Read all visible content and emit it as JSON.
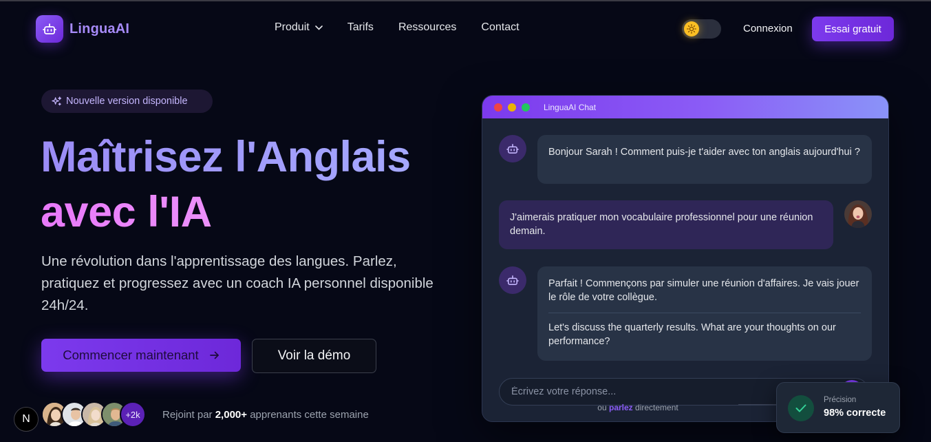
{
  "brand": {
    "name": "LinguaAI"
  },
  "nav": {
    "items": [
      {
        "label": "Produit",
        "has_dropdown": true
      },
      {
        "label": "Tarifs",
        "has_dropdown": false
      },
      {
        "label": "Ressources",
        "has_dropdown": false
      },
      {
        "label": "Contact",
        "has_dropdown": false
      }
    ],
    "theme_toggle": {
      "icon": "sun-icon",
      "state": "light"
    },
    "login_label": "Connexion",
    "trial_label": "Essai gratuit"
  },
  "hero": {
    "badge_label": "Nouvelle version disponible",
    "title_line1": "Maîtrisez l'Anglais",
    "title_line2": "avec l'IA",
    "subtitle": "Une révolution dans l'apprentissage des langues. Parlez, pratiquez et progressez avec un coach IA personnel disponible 24h/24.",
    "cta_primary": "Commencer maintenant",
    "cta_secondary": "Voir la démo",
    "social_proof": {
      "more_count": "+2k",
      "text_prefix": "Rejoint par",
      "count": "2,000+",
      "text_suffix": "apprenants cette semaine"
    }
  },
  "chat": {
    "title": "LinguaAI Chat",
    "messages": [
      {
        "role": "bot",
        "text": "Bonjour Sarah ! Comment puis-je t'aider avec ton anglais aujourd'hui ?"
      },
      {
        "role": "user",
        "text": "J'aimerais pratiquer mon vocabulaire professionnel pour une réunion demain."
      },
      {
        "role": "bot",
        "text": "Parfait ! Commençons par simuler une réunion d'affaires. Je vais jouer le rôle de votre collègue.",
        "english": "Let's discuss the quarterly results. What are your thoughts on our performance?"
      }
    ],
    "input_placeholder": "Écrivez votre réponse...",
    "speak_prefix": "ou",
    "speak_link": "parlez",
    "speak_suffix": "directement"
  },
  "precision_card": {
    "label": "Précision",
    "value": "98% correcte"
  },
  "dev_badge": {
    "letter": "N"
  },
  "colors": {
    "background": "#060816",
    "accent": "#7c3aed",
    "title_gradient_1": "#9b8cf6",
    "title_gradient_2": "#e879f9",
    "success": "#10b981"
  }
}
